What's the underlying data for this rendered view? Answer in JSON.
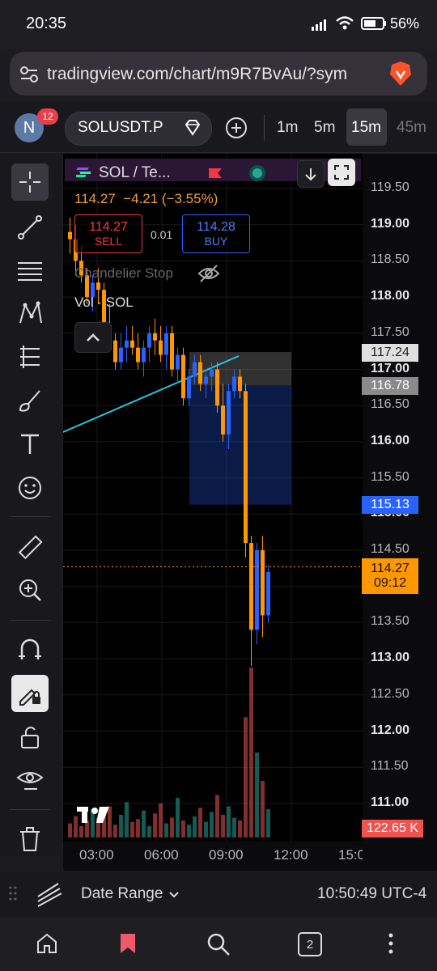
{
  "status_bar": {
    "time": "20:35",
    "battery": "56%"
  },
  "browser": {
    "url": "tradingview.com/chart/m9R7BvAu/?sym"
  },
  "header": {
    "avatar_letter": "N",
    "notif_count": "12",
    "symbol": "SOLUSDT.P",
    "timeframes": [
      "1m",
      "5m",
      "15m",
      "45m"
    ],
    "active_timeframe": "15m"
  },
  "legend": {
    "title": "SOL / Te...",
    "change": "114.27  −4.21 (−3.55%)",
    "sell_price": "114.27",
    "sell_label": "SELL",
    "spread": "0.01",
    "buy_price": "114.28",
    "buy_label": "BUY",
    "indicator_1": "Chandelier Stop",
    "indicator_2": "Vol · SOL"
  },
  "price_axis": {
    "labels": [
      "119.50",
      "119.00",
      "118.50",
      "118.00",
      "117.50",
      "117.00",
      "116.50",
      "116.00",
      "115.50",
      "115.00",
      "114.50",
      "114.00",
      "113.50",
      "113.00",
      "112.50",
      "112.00",
      "111.50",
      "111.00"
    ],
    "tag_top": "117.24",
    "tag_mid": "116.78",
    "tag_blue": "115.13",
    "tag_last": "114.27",
    "tag_countdown": "09:12",
    "tag_volume": "122.65 K"
  },
  "time_axis": {
    "labels": [
      "03:00",
      "06:00",
      "09:00",
      "12:00",
      "15:0"
    ]
  },
  "bottom": {
    "date_range_label": "Date Range",
    "clock": "10:50:49 UTC-4",
    "tab_count": "2"
  },
  "colors": {
    "bull": "#2962ff",
    "bear": "#ff9800",
    "accent_red": "#f23645",
    "trendline": "#26c6da"
  },
  "chart_data": {
    "type": "candlestick",
    "y_range": [
      110.7,
      119.8
    ],
    "candles": [
      [
        118.9,
        119.1,
        118.6,
        118.8
      ],
      [
        118.8,
        119.0,
        118.3,
        118.5
      ],
      [
        118.5,
        118.7,
        118.2,
        118.3
      ],
      [
        118.3,
        118.4,
        117.9,
        118.0
      ],
      [
        118.0,
        118.3,
        117.8,
        118.2
      ],
      [
        118.2,
        118.4,
        117.9,
        118.1
      ],
      [
        118.1,
        118.2,
        117.5,
        117.6
      ],
      [
        117.6,
        117.9,
        117.3,
        117.4
      ],
      [
        117.4,
        117.5,
        117.0,
        117.1
      ],
      [
        117.1,
        117.5,
        117.0,
        117.3
      ],
      [
        117.3,
        117.6,
        117.1,
        117.4
      ],
      [
        117.4,
        117.6,
        117.2,
        117.3
      ],
      [
        117.3,
        117.5,
        117.0,
        117.1
      ],
      [
        117.1,
        117.4,
        116.9,
        117.3
      ],
      [
        117.3,
        117.6,
        117.1,
        117.5
      ],
      [
        117.5,
        117.7,
        117.2,
        117.4
      ],
      [
        117.4,
        117.6,
        117.1,
        117.2
      ],
      [
        117.2,
        117.6,
        117.0,
        117.5
      ],
      [
        117.5,
        117.6,
        116.9,
        117.0
      ],
      [
        117.0,
        117.3,
        116.8,
        117.2
      ],
      [
        117.2,
        117.3,
        116.5,
        116.6
      ],
      [
        116.6,
        117.0,
        116.5,
        116.9
      ],
      [
        116.9,
        117.2,
        116.8,
        117.1
      ],
      [
        117.1,
        117.2,
        116.7,
        116.8
      ],
      [
        116.8,
        117.0,
        116.6,
        116.9
      ],
      [
        116.9,
        117.1,
        116.7,
        117.0
      ],
      [
        117.0,
        117.1,
        116.4,
        116.5
      ],
      [
        116.5,
        116.8,
        116.0,
        116.1
      ],
      [
        116.1,
        116.8,
        115.9,
        116.7
      ],
      [
        116.7,
        117.0,
        116.6,
        116.9
      ],
      [
        116.9,
        117.0,
        116.6,
        116.7
      ],
      [
        116.7,
        116.8,
        114.4,
        114.6
      ],
      [
        114.6,
        114.7,
        112.9,
        113.4
      ],
      [
        113.4,
        114.6,
        113.2,
        114.5
      ],
      [
        114.5,
        114.7,
        113.3,
        113.6
      ],
      [
        113.6,
        114.3,
        113.5,
        114.2
      ]
    ],
    "volumes": [
      10,
      15,
      8,
      12,
      20,
      14,
      18,
      22,
      9,
      16,
      25,
      11,
      13,
      19,
      8,
      17,
      24,
      10,
      14,
      28,
      12,
      9,
      15,
      21,
      11,
      18,
      30,
      16,
      22,
      14,
      12,
      85,
      120,
      60,
      40,
      20
    ]
  }
}
